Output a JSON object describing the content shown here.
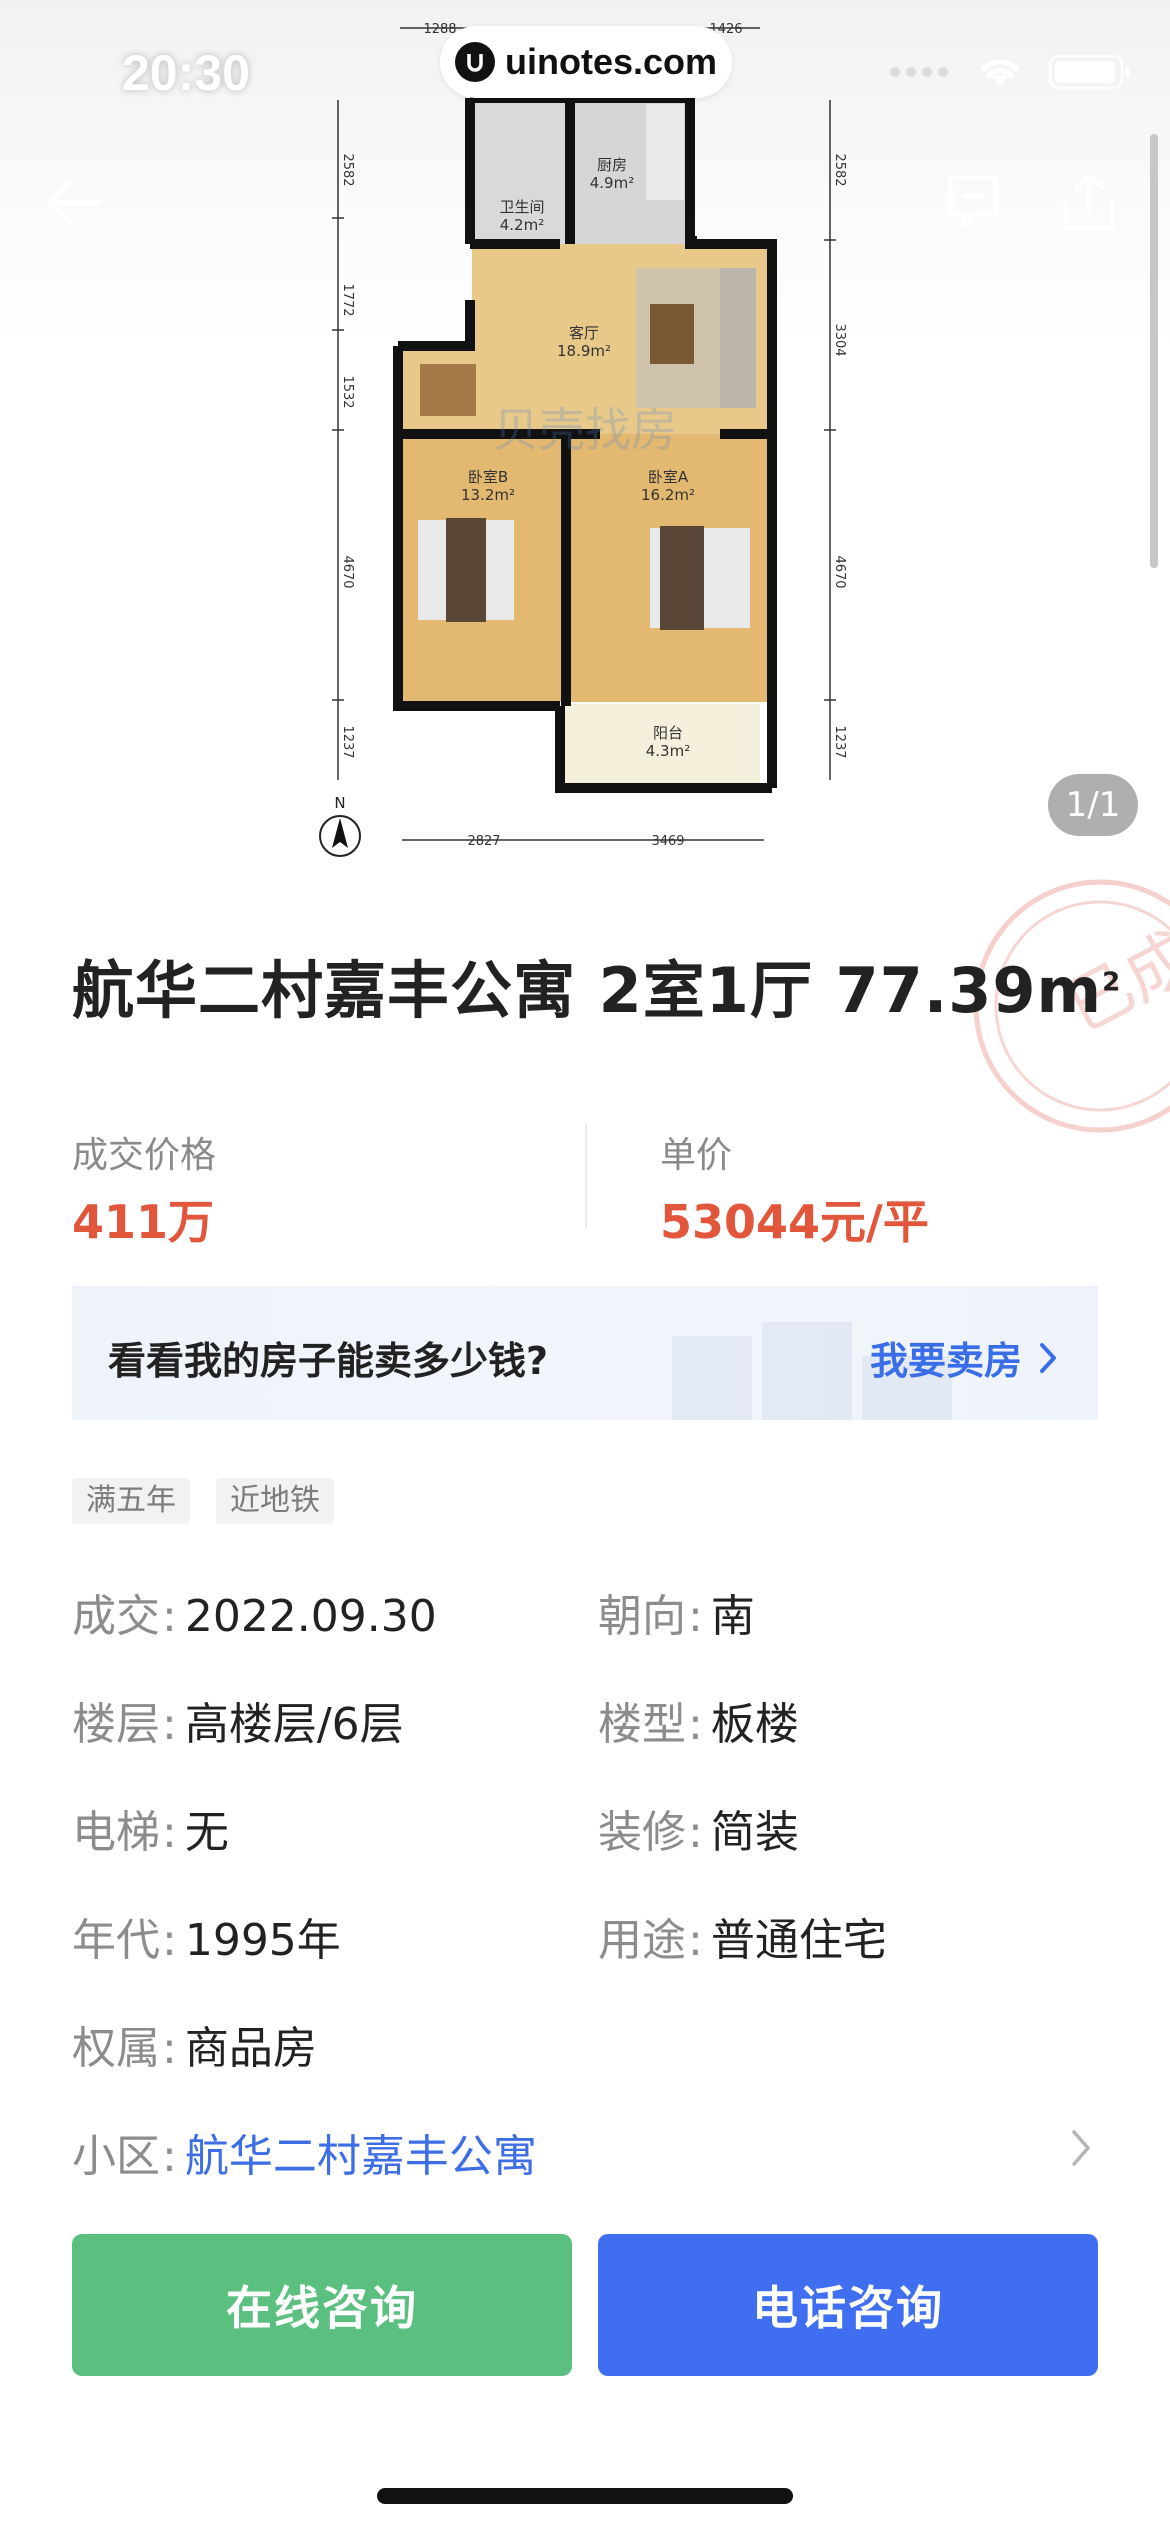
{
  "status_bar": {
    "time": "20:30",
    "watermark": "uinotes.com"
  },
  "gallery": {
    "page_indicator": "1/1"
  },
  "floor_plan": {
    "rooms": {
      "bathroom": {
        "name": "卫生间",
        "area": "4.2m²"
      },
      "kitchen": {
        "name": "厨房",
        "area": "4.9m²"
      },
      "living": {
        "name": "客厅",
        "area": "18.9m²"
      },
      "bedroom_b": {
        "name": "卧室B",
        "area": "13.2m²"
      },
      "bedroom_a": {
        "name": "卧室A",
        "area": "16.2m²"
      },
      "balcony": {
        "name": "阳台",
        "area": "4.3m²"
      }
    },
    "dims_top": [
      "1288",
      "1426"
    ],
    "dims_left": [
      "2582",
      "1772",
      "1532",
      "4670",
      "1237"
    ],
    "dims_right": [
      "2582",
      "3304",
      "4670",
      "1237"
    ],
    "dims_bottom": [
      "2827",
      "3469"
    ],
    "compass": "N",
    "brand_watermark": "贝壳找房"
  },
  "listing": {
    "title": "航华二村嘉丰公寓 2室1厅 77.39m",
    "title_sup": "2",
    "stamp_text": "已成交",
    "deal_price_label": "成交价格",
    "deal_price": "411万",
    "unit_price_label": "单价",
    "unit_price": "53044元/平"
  },
  "sell_banner": {
    "question": "看看我的房子能卖多少钱?",
    "cta": "我要卖房"
  },
  "tags": [
    "满五年",
    "近地铁"
  ],
  "info": {
    "sep": ":",
    "deal": {
      "k": "成交",
      "v": "2022.09.30"
    },
    "orientation": {
      "k": "朝向",
      "v": "南"
    },
    "floor": {
      "k": "楼层",
      "v": "高楼层/6层"
    },
    "building_type": {
      "k": "楼型",
      "v": "板楼"
    },
    "elevator": {
      "k": "电梯",
      "v": "无"
    },
    "decoration": {
      "k": "装修",
      "v": "简装"
    },
    "year": {
      "k": "年代",
      "v": "1995年"
    },
    "usage": {
      "k": "用途",
      "v": "普通住宅"
    },
    "ownership": {
      "k": "权属",
      "v": "商品房"
    },
    "community": {
      "k": "小区",
      "v": "航华二村嘉丰公寓"
    }
  },
  "actions": {
    "online": "在线咨询",
    "phone": "电话咨询"
  },
  "colors": {
    "price": "#e2563b",
    "link": "#3d6ee6",
    "green_button": "#5bbf80",
    "blue_button": "#3f6ef0"
  }
}
